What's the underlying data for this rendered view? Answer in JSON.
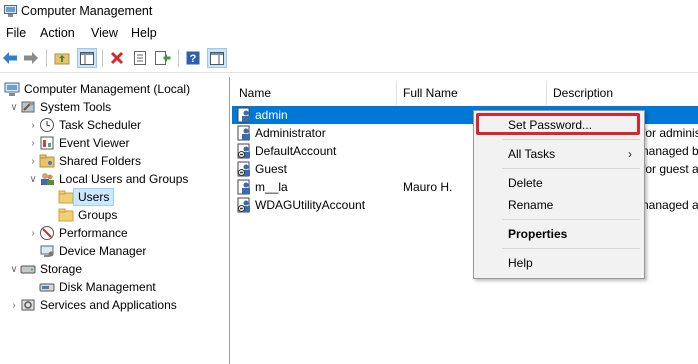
{
  "window": {
    "title": "Computer Management"
  },
  "menu": [
    "File",
    "Action",
    "View",
    "Help"
  ],
  "toolbar": {
    "icons": [
      "back-arrow-icon",
      "forward-arrow-icon",
      "up-folder-icon",
      "show-hide-tree-icon",
      "delete-icon",
      "properties-icon",
      "export-list-icon",
      "help-icon",
      "show-hide-action-pane-icon"
    ]
  },
  "tree": {
    "root": "Computer Management (Local)",
    "system_tools": "System Tools",
    "task_scheduler": "Task Scheduler",
    "event_viewer": "Event Viewer",
    "shared_folders": "Shared Folders",
    "local_users_groups": "Local Users and Groups",
    "users": "Users",
    "groups": "Groups",
    "performance": "Performance",
    "device_manager": "Device Manager",
    "storage": "Storage",
    "disk_management": "Disk Management",
    "services_apps": "Services and Applications"
  },
  "list": {
    "columns": {
      "name": "Name",
      "full_name": "Full Name",
      "description": "Description"
    },
    "rows": [
      {
        "name": "admin",
        "full_name": "",
        "description": ""
      },
      {
        "name": "Administrator",
        "full_name": "",
        "description": "for adminis"
      },
      {
        "name": "DefaultAccount",
        "full_name": "",
        "description": "nanaged by"
      },
      {
        "name": "Guest",
        "full_name": "",
        "description": "for guest a"
      },
      {
        "name": "m__la",
        "full_name": "Mauro H.",
        "description": ""
      },
      {
        "name": "WDAGUtilityAccount",
        "full_name": "",
        "description": "nanaged ar"
      }
    ]
  },
  "context_menu": {
    "set_password": "Set Password...",
    "all_tasks": "All Tasks",
    "delete": "Delete",
    "rename": "Rename",
    "properties": "Properties",
    "help": "Help"
  },
  "colors": {
    "selection": "#0078d7",
    "highlight_box": "#d9252e",
    "tree_selection": "#cce8ff"
  }
}
